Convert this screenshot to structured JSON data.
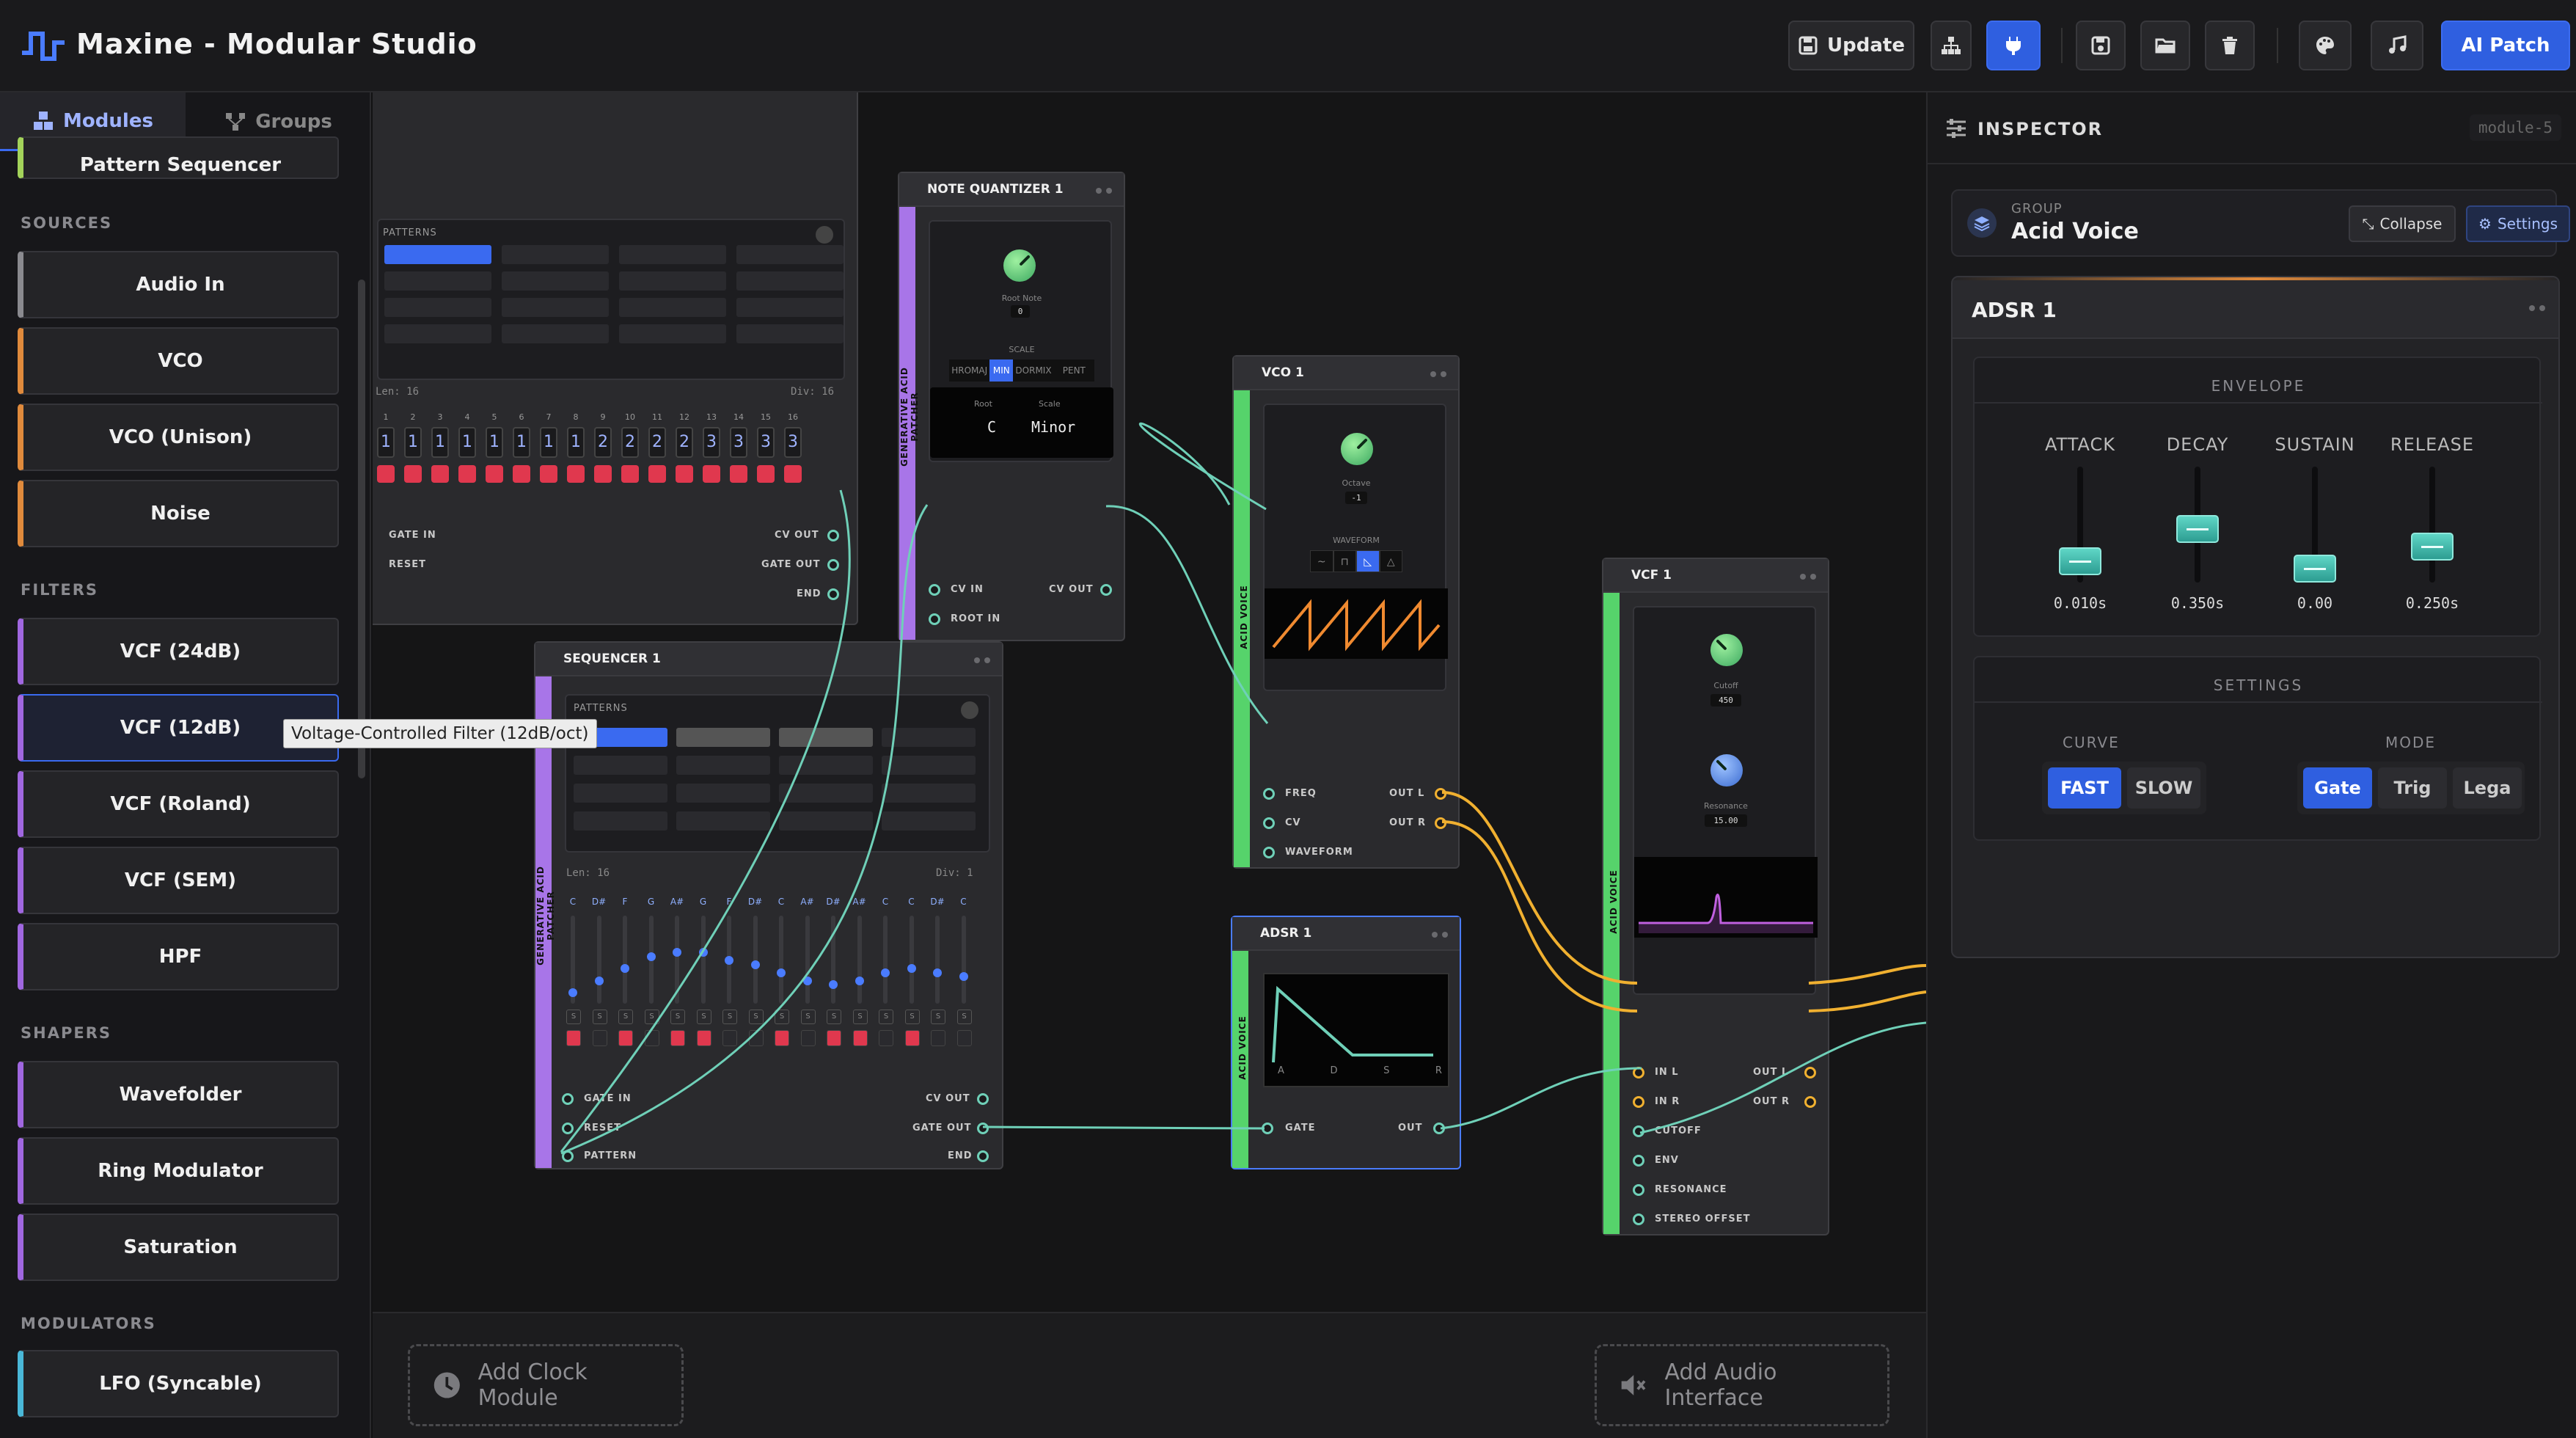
{
  "app": {
    "title": "Maxine - Modular Studio"
  },
  "toolbar": {
    "update_label": "Update",
    "ai_patch_label": "AI Patch",
    "icons": [
      "save-icon",
      "hierarchy-icon",
      "plug-icon",
      "disk-icon",
      "folder-icon",
      "trash-icon",
      "palette-icon",
      "music-note-icon"
    ]
  },
  "sidebar": {
    "tabs": [
      {
        "label": "Modules"
      },
      {
        "label": "Groups"
      }
    ],
    "partial_item": "Pattern Sequencer",
    "sections": {
      "sources": {
        "title": "SOURCES",
        "items": [
          "Audio In",
          "VCO",
          "VCO (Unison)",
          "Noise"
        ]
      },
      "filters": {
        "title": "FILTERS",
        "items": [
          "VCF (24dB)",
          "VCF (12dB)",
          "VCF (Roland)",
          "VCF (SEM)",
          "HPF"
        ]
      },
      "shapers": {
        "title": "SHAPERS",
        "items": [
          "Wavefolder",
          "Ring Modulator",
          "Saturation"
        ]
      },
      "modulators": {
        "title": "MODULATORS",
        "items": [
          "LFO (Syncable)"
        ]
      }
    },
    "tooltip": "Voltage-Controlled Filter (12dB/oct)"
  },
  "canvas": {
    "pattern_seq": {
      "patterns_label": "PATTERNS",
      "len": "Len: 16",
      "div": "Div: 16",
      "steps": [
        "1",
        "2",
        "3",
        "4",
        "5",
        "6",
        "7",
        "8",
        "9",
        "10",
        "11",
        "12",
        "13",
        "14",
        "15",
        "16"
      ],
      "step_values": [
        "1",
        "1",
        "1",
        "1",
        "1",
        "1",
        "1",
        "1",
        "2",
        "2",
        "2",
        "2",
        "3",
        "3",
        "3",
        "3"
      ],
      "ports_in": [
        "GATE IN",
        "RESET"
      ],
      "ports_out": [
        "CV OUT",
        "GATE OUT",
        "END"
      ]
    },
    "note_quantizer": {
      "title": "NOTE QUANTIZER 1",
      "group_label": "GENERATIVE ACID PATCHER",
      "root_note_label": "Root Note",
      "root_note_value": "0",
      "scale_label": "SCALE",
      "scales": [
        "HROMAJ",
        "MIN",
        "DORMIX",
        "PENT"
      ],
      "root_head": "Root",
      "scale_head": "Scale",
      "root_val": "C",
      "scale_val": "Minor",
      "ports_in": [
        "CV IN",
        "ROOT IN"
      ],
      "port_out": "CV OUT"
    },
    "vco": {
      "title": "VCO 1",
      "group_label": "ACID VOICE",
      "octave_label": "Octave",
      "octave_value": "-1",
      "waveform_label": "WAVEFORM",
      "waveforms": [
        "~",
        "⊓",
        "◺",
        "△"
      ],
      "ports_in": [
        "FREQ",
        "CV",
        "WAVEFORM"
      ],
      "ports_out": [
        "OUT L",
        "OUT R"
      ]
    },
    "sequencer": {
      "title": "SEQUENCER 1",
      "group_label": "GENERATIVE ACID PATCHER",
      "patterns_label": "PATTERNS",
      "len": "Len: 16",
      "div": "Div: 1",
      "notes": [
        "C",
        "D#",
        "F",
        "G",
        "A#",
        "G",
        "F",
        "D#",
        "C",
        "A#",
        "D#",
        "A#",
        "C",
        "C",
        "D#",
        "C"
      ],
      "slide_mark": "S",
      "ports_in": [
        "GATE IN",
        "RESET",
        "PATTERN"
      ],
      "ports_out": [
        "CV OUT",
        "GATE OUT",
        "END"
      ]
    },
    "adsr": {
      "title": "ADSR 1",
      "group_label": "ACID VOICE",
      "stage_labels": [
        "A",
        "D",
        "S",
        "R"
      ],
      "port_in": "GATE",
      "port_out": "OUT"
    },
    "vcf": {
      "title": "VCF 1",
      "group_label": "ACID VOICE",
      "cutoff_label": "Cutoff",
      "cutoff_value": "450",
      "resonance_label": "Resonance",
      "resonance_value": "15.00",
      "ports_in": [
        "IN L",
        "IN R",
        "CUTOFF",
        "ENV",
        "RESONANCE",
        "STEREO OFFSET"
      ],
      "ports_out": [
        "OUT L",
        "OUT R"
      ]
    },
    "add_clock": "Add Clock Module",
    "add_audio": "Add Audio Interface"
  },
  "inspector": {
    "title": "INSPECTOR",
    "module_id": "module-5",
    "group_caption": "GROUP",
    "group_name": "Acid Voice",
    "collapse_label": "Collapse",
    "settings_label": "Settings",
    "card_title": "ADSR 1",
    "envelope_title": "ENVELOPE",
    "params": [
      {
        "label": "ATTACK",
        "value": "0.010s",
        "level": 0.08
      },
      {
        "label": "DECAY",
        "value": "0.350s",
        "level": 0.45
      },
      {
        "label": "SUSTAIN",
        "value": "0.00",
        "level": 0.0
      },
      {
        "label": "RELEASE",
        "value": "0.250s",
        "level": 0.25
      }
    ],
    "settings_title": "SETTINGS",
    "curve_label": "CURVE",
    "curve_options": [
      "FAST",
      "SLOW"
    ],
    "curve_selected": "FAST",
    "mode_label": "MODE",
    "mode_options": [
      "Gate",
      "Trig",
      "Lega"
    ],
    "mode_selected": "Gate"
  },
  "colors": {
    "accent": "#2f5fe0",
    "acid_voice": "#56d36b",
    "patcher": "#a875e8",
    "wire_teal": "#6fd0b8",
    "wire_yellow": "#f0b030",
    "step_red": "#e0384e"
  }
}
